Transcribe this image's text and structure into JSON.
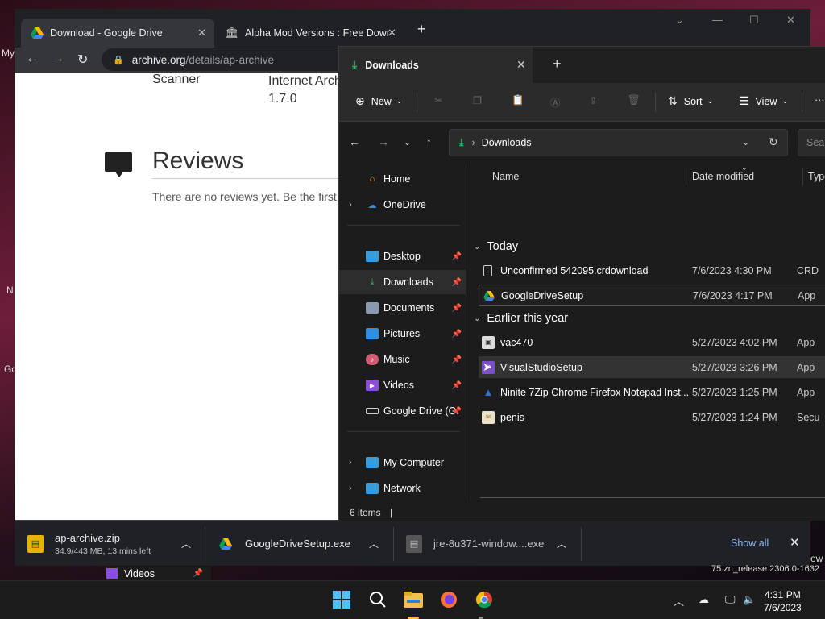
{
  "desktop": {
    "frag_my": "My",
    "frag_n": "N",
    "frag_go": "Go",
    "frag_ew": "ew"
  },
  "chrome": {
    "tabs": [
      {
        "title": "Download - Google Drive",
        "close": "✕"
      },
      {
        "title": "Alpha Mod Versions : Free Downl",
        "close": "✕"
      }
    ],
    "new_tab": "+",
    "url_host": "archive.org",
    "url_path": "/details/ap-archive",
    "page": {
      "col1": "Scanner",
      "col2_line1": "Internet Arch",
      "col2_line2": "1.7.0",
      "reviews_title": "Reviews",
      "reviews_text": "There are no reviews yet. Be the first"
    },
    "downloads": [
      {
        "name": "ap-archive.zip",
        "status": "34.9/443 MB, 13 mins left"
      },
      {
        "name": "GoogleDriveSetup.exe"
      },
      {
        "name": "jre-8u371-window....exe"
      }
    ],
    "show_all": "Show all"
  },
  "explorer": {
    "tab_title": "Downloads",
    "commands": {
      "new": "New",
      "sort": "Sort",
      "view": "View",
      "more": "···"
    },
    "address": {
      "location": "Downloads",
      "search_placeholder": "Search"
    },
    "nav": [
      {
        "label": "Home"
      },
      {
        "label": "OneDrive"
      },
      {
        "label": "Desktop"
      },
      {
        "label": "Downloads"
      },
      {
        "label": "Documents"
      },
      {
        "label": "Pictures"
      },
      {
        "label": "Music"
      },
      {
        "label": "Videos"
      },
      {
        "label": "Google Drive (G:"
      },
      {
        "label": "My Computer"
      },
      {
        "label": "Network"
      }
    ],
    "columns": {
      "name": "Name",
      "date": "Date modified",
      "type": "Type"
    },
    "groups": [
      {
        "label": "Today",
        "files": [
          {
            "name": "Unconfirmed 542095.crdownload",
            "date": "7/6/2023 4:30 PM",
            "type": "CRD"
          },
          {
            "name": "GoogleDriveSetup",
            "date": "7/6/2023 4:17 PM",
            "type": "App"
          }
        ]
      },
      {
        "label": "Earlier this year",
        "files": [
          {
            "name": "vac470",
            "date": "5/27/2023 4:02 PM",
            "type": "App"
          },
          {
            "name": "VisualStudioSetup",
            "date": "5/27/2023 3:26 PM",
            "type": "App"
          },
          {
            "name": "Ninite 7Zip Chrome Firefox Notepad Inst...",
            "date": "5/27/2023 1:25 PM",
            "type": "App"
          },
          {
            "name": "penis",
            "date": "5/27/2023 1:24 PM",
            "type": "Secu"
          }
        ]
      }
    ],
    "status": "6 items"
  },
  "behind": {
    "videos": "Videos",
    "release": "75.zn_release.2306.0-1632"
  },
  "taskbar": {
    "time": "4:31 PM",
    "date": "7/6/2023"
  },
  "colors": {
    "accent": "#3bb273",
    "link": "#8ab4f8",
    "active_indicator": "#ffb84d"
  }
}
